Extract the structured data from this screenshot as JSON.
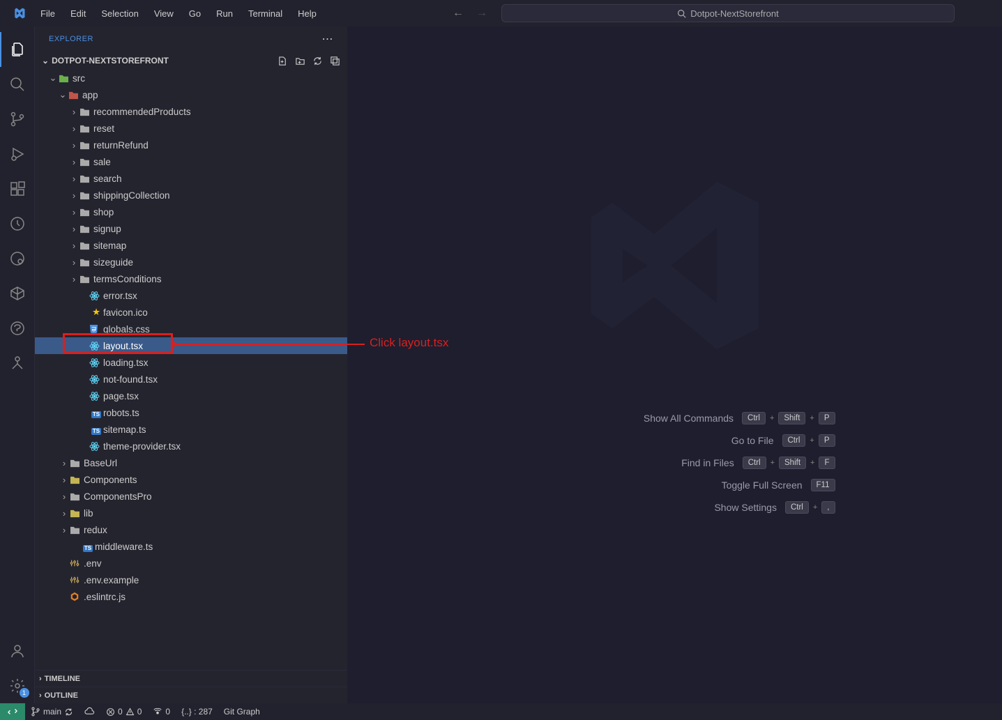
{
  "title_bar": {
    "menus": [
      "File",
      "Edit",
      "Selection",
      "View",
      "Go",
      "Run",
      "Terminal",
      "Help"
    ],
    "search_text": "Dotpot-NextStorefront"
  },
  "sidebar": {
    "header": "EXPLORER",
    "folder": "DOTPOT-NEXTSTOREFRONT",
    "tree": [
      {
        "kind": "folder-open",
        "label": "src",
        "depth": 1,
        "color": "g"
      },
      {
        "kind": "folder-open",
        "label": "app",
        "depth": 2,
        "color": "r"
      },
      {
        "kind": "folder",
        "label": "recommendedProducts",
        "depth": 3
      },
      {
        "kind": "folder",
        "label": "reset",
        "depth": 3
      },
      {
        "kind": "folder",
        "label": "returnRefund",
        "depth": 3
      },
      {
        "kind": "folder",
        "label": "sale",
        "depth": 3
      },
      {
        "kind": "folder",
        "label": "search",
        "depth": 3
      },
      {
        "kind": "folder",
        "label": "shippingCollection",
        "depth": 3
      },
      {
        "kind": "folder",
        "label": "shop",
        "depth": 3
      },
      {
        "kind": "folder",
        "label": "signup",
        "depth": 3
      },
      {
        "kind": "folder",
        "label": "sitemap",
        "depth": 3
      },
      {
        "kind": "folder",
        "label": "sizeguide",
        "depth": 3
      },
      {
        "kind": "folder",
        "label": "termsConditions",
        "depth": 3
      },
      {
        "kind": "react",
        "label": "error.tsx",
        "depth": 3
      },
      {
        "kind": "star",
        "label": "favicon.ico",
        "depth": 3
      },
      {
        "kind": "css",
        "label": "globals.css",
        "depth": 3
      },
      {
        "kind": "react",
        "label": "layout.tsx",
        "depth": 3,
        "selected": true
      },
      {
        "kind": "react",
        "label": "loading.tsx",
        "depth": 3
      },
      {
        "kind": "react",
        "label": "not-found.tsx",
        "depth": 3
      },
      {
        "kind": "react",
        "label": "page.tsx",
        "depth": 3
      },
      {
        "kind": "ts",
        "label": "robots.ts",
        "depth": 3
      },
      {
        "kind": "ts",
        "label": "sitemap.ts",
        "depth": 3
      },
      {
        "kind": "react",
        "label": "theme-provider.tsx",
        "depth": 3
      },
      {
        "kind": "folder",
        "label": "BaseUrl",
        "depth": 2
      },
      {
        "kind": "folder",
        "label": "Components",
        "depth": 2,
        "color": "y"
      },
      {
        "kind": "folder",
        "label": "ComponentsPro",
        "depth": 2
      },
      {
        "kind": "folder",
        "label": "lib",
        "depth": 2,
        "color": "y"
      },
      {
        "kind": "folder",
        "label": "redux",
        "depth": 2
      },
      {
        "kind": "ts",
        "label": "middleware.ts",
        "depth": 2
      },
      {
        "kind": "toml",
        "label": ".env",
        "depth": 1
      },
      {
        "kind": "toml",
        "label": ".env.example",
        "depth": 1
      },
      {
        "kind": "js",
        "label": ".eslintrc.js",
        "depth": 1
      }
    ],
    "sections": [
      "TIMELINE",
      "OUTLINE"
    ]
  },
  "shortcuts": [
    {
      "label": "Show All Commands",
      "keys": [
        "Ctrl",
        "Shift",
        "P"
      ]
    },
    {
      "label": "Go to File",
      "keys": [
        "Ctrl",
        "P"
      ]
    },
    {
      "label": "Find in Files",
      "keys": [
        "Ctrl",
        "Shift",
        "F"
      ]
    },
    {
      "label": "Toggle Full Screen",
      "keys": [
        "F11"
      ]
    },
    {
      "label": "Show Settings",
      "keys": [
        "Ctrl",
        ","
      ]
    }
  ],
  "status": {
    "branch": "main",
    "errors": "0",
    "warnings": "0",
    "radio": "0",
    "bracket": "{..} : 287",
    "gitgraph": "Git Graph"
  },
  "annotation": {
    "text": "Click layout.tsx"
  },
  "settings_badge": "1"
}
